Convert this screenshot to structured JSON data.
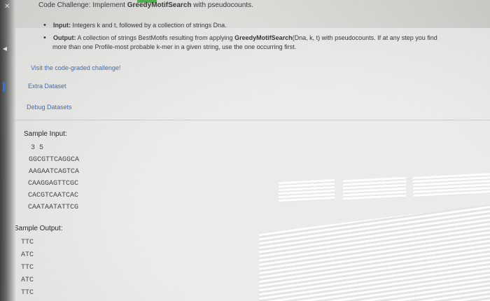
{
  "title": {
    "prefix": "Code Challenge: Implement ",
    "bold": "GreedyMotifSearch",
    "suffix": " with pseudocounts."
  },
  "input_bullet": {
    "label": "Input:",
    "text": " Integers k and t, followed by a collection of strings Dna."
  },
  "output_bullet": {
    "label": "Output:",
    "text1": " A collection of strings BestMotifs resulting from applying ",
    "bold": "GreedyMotifSearch",
    "text2": "(Dna, k, t) with pseudocounts. If at any step you find",
    "cont": "more than one Profile-most probable k-mer in a given string, use the one occurring first."
  },
  "links": {
    "visit": "Visit the code-graded challenge!",
    "extra": "Extra Dataset",
    "debug": "Debug Datasets"
  },
  "sample_input": {
    "heading": "Sample Input:",
    "lines": [
      "3 5",
      "GGCGTTCAGGCA",
      "AAGAATCAGTCA",
      "CAAGGAGTTCGC",
      "CACGTCAATCAC",
      "CAATAATATTCG"
    ]
  },
  "sample_output": {
    "heading": "Sample Output:",
    "lines": [
      "TTC",
      "ATC",
      "TTC",
      "ATC",
      "TTC"
    ]
  }
}
